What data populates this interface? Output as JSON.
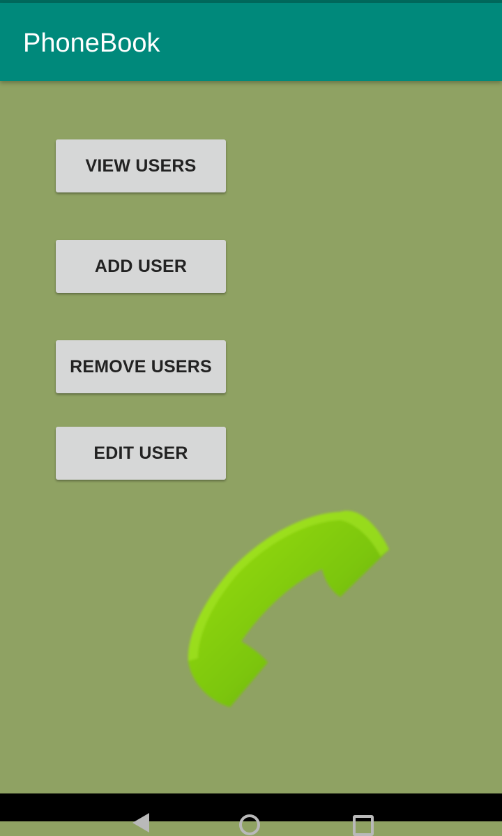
{
  "app_bar": {
    "title": "PhoneBook",
    "color": "#00897b"
  },
  "main": {
    "background_color": "#8fa263",
    "buttons": [
      {
        "label": "VIEW USERS"
      },
      {
        "label": "ADD USER"
      },
      {
        "label": "REMOVE USERS"
      },
      {
        "label": "EDIT USER"
      }
    ],
    "image": {
      "icon": "phone-handset-icon",
      "color": "#7dc40a"
    }
  },
  "nav_bar": {
    "back_icon": "back-icon",
    "home_icon": "home-icon",
    "recents_icon": "recents-icon"
  }
}
